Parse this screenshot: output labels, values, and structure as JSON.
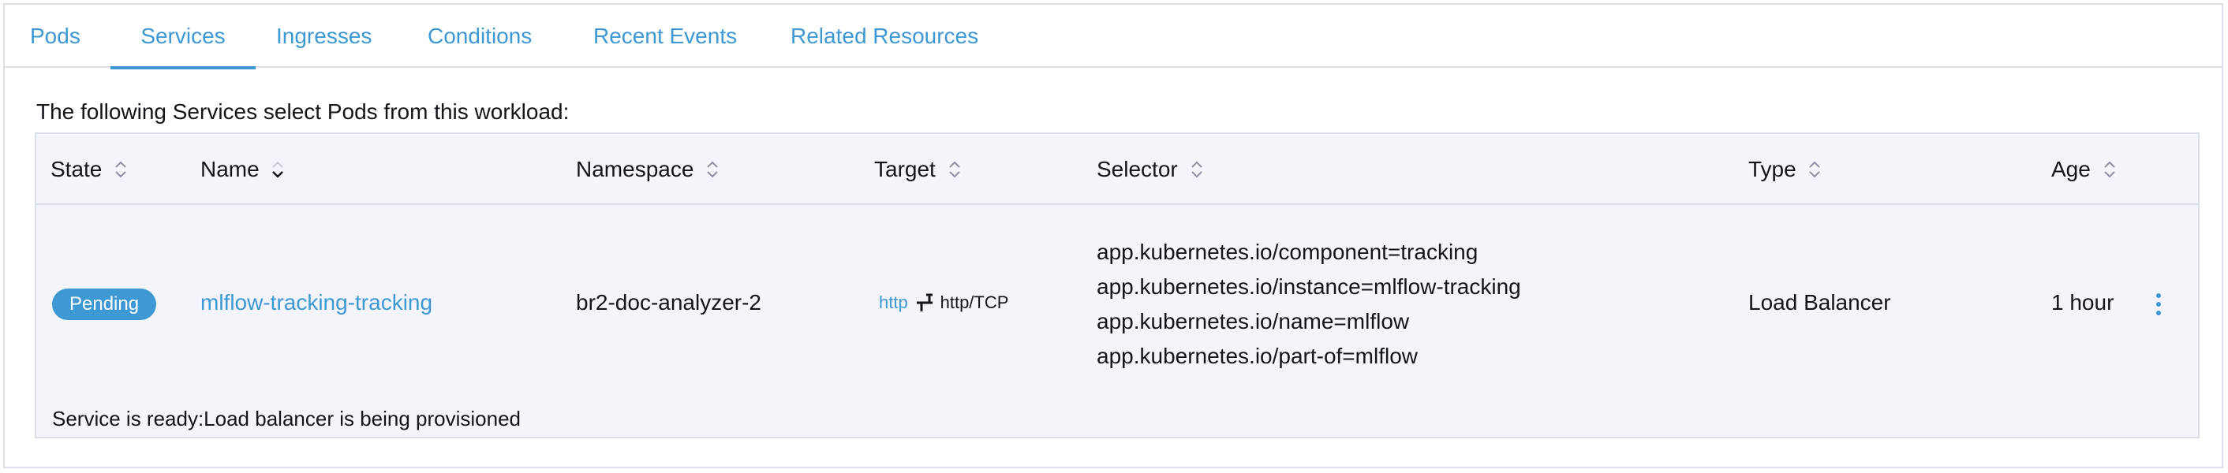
{
  "tabs": [
    {
      "label": "Pods",
      "active": false
    },
    {
      "label": "Services",
      "active": true
    },
    {
      "label": "Ingresses",
      "active": false
    },
    {
      "label": "Conditions",
      "active": false
    },
    {
      "label": "Recent Events",
      "active": false
    },
    {
      "label": "Related Resources",
      "active": false
    }
  ],
  "intro_text": "The following Services select Pods from this workload:",
  "table": {
    "headers": {
      "state": "State",
      "name": "Name",
      "namespace": "Namespace",
      "target": "Target",
      "selector": "Selector",
      "type": "Type",
      "age": "Age"
    },
    "sorted_column": "name",
    "rows": [
      {
        "state": "Pending",
        "name": "mlflow-tracking-tracking",
        "namespace": "br2-doc-analyzer-2",
        "target_protocol": "http",
        "target_port": "http/TCP",
        "selector": [
          "app.kubernetes.io/component=tracking",
          "app.kubernetes.io/instance=mlflow-tracking",
          "app.kubernetes.io/name=mlflow",
          "app.kubernetes.io/part-of=mlflow"
        ],
        "type": "Load Balancer",
        "age": "1 hour",
        "status_message": "Service is ready:Load balancer is being provisioned"
      }
    ]
  },
  "colors": {
    "accent": "#3d98d3",
    "border": "#dcdee7",
    "table_bg": "#f4f5fa",
    "text": "#141419"
  },
  "icons": {
    "sort": "sort-updown-icon",
    "sort_active": "sort-down-icon",
    "port_mapping": "port-mapping-icon",
    "actions": "kebab-menu-icon"
  }
}
